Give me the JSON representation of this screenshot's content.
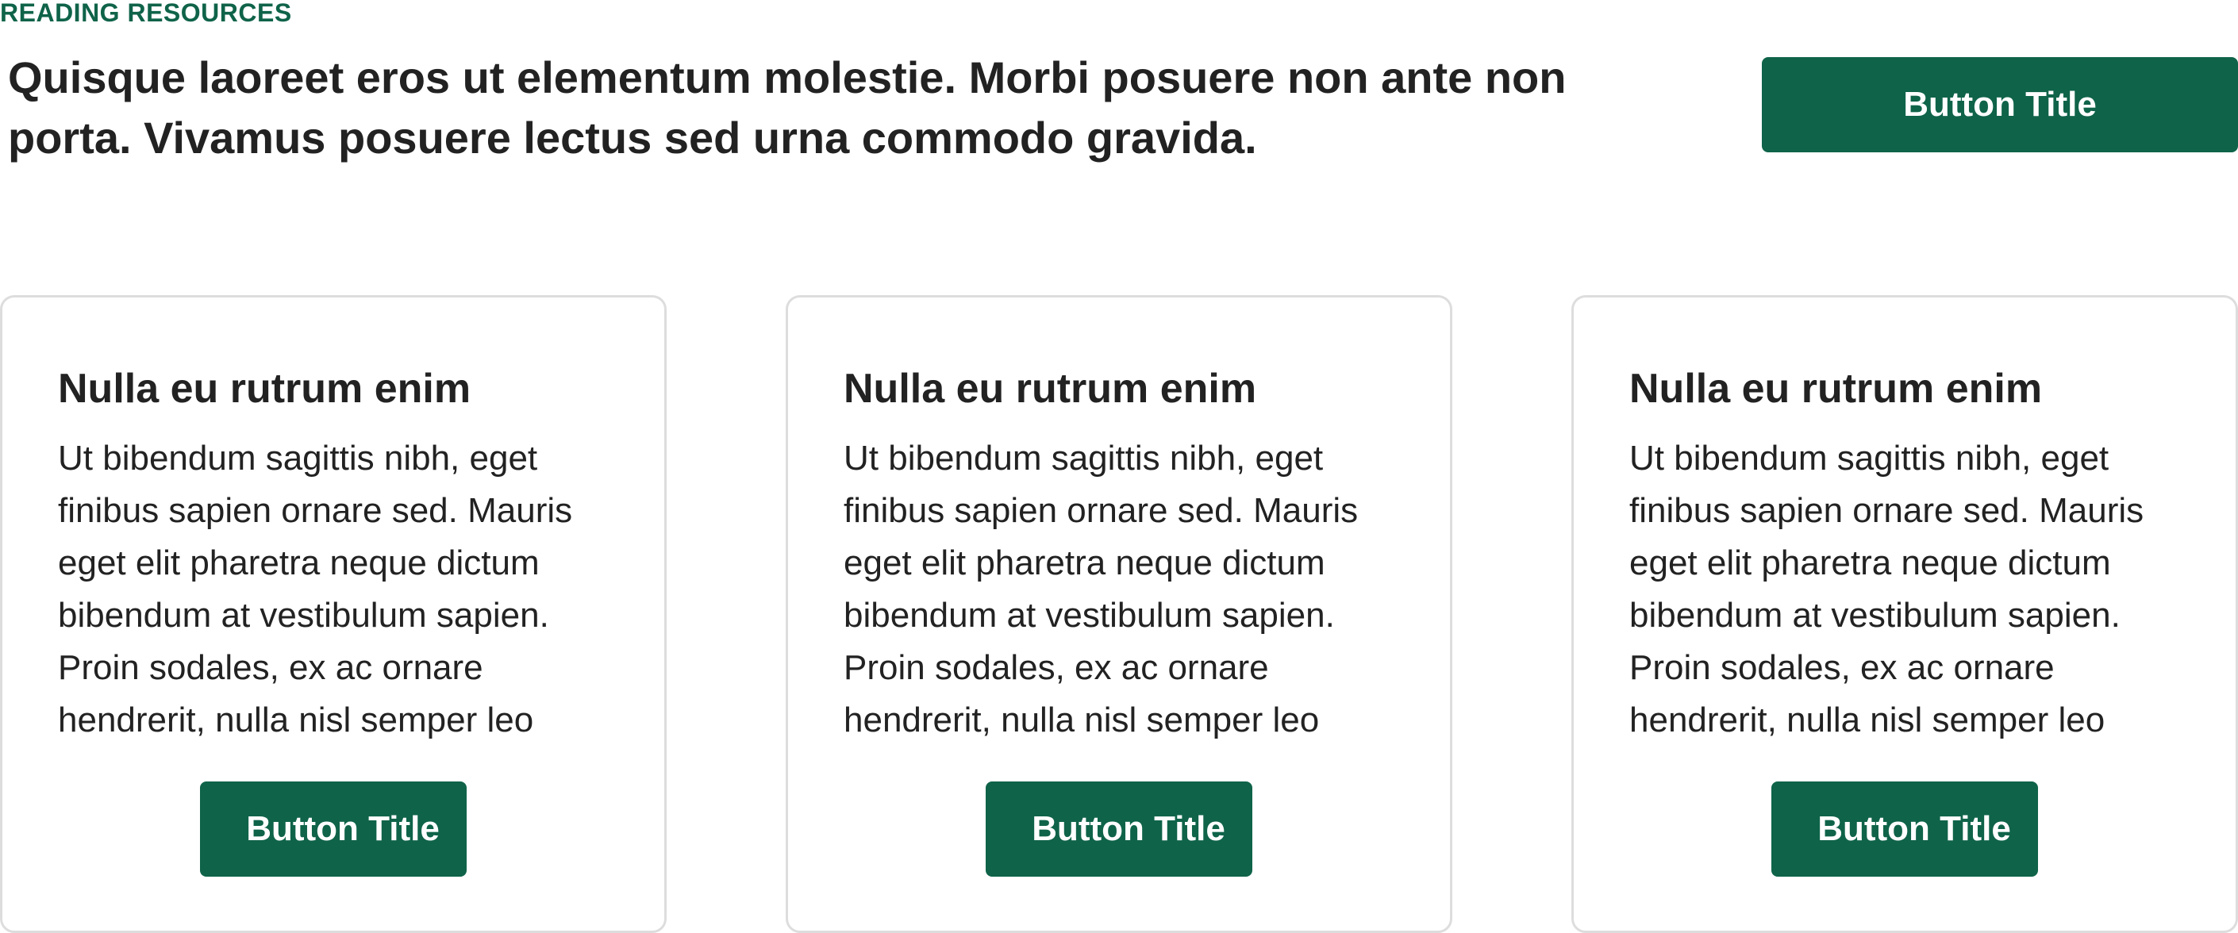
{
  "section": {
    "eyebrow": "READING RESOURCES",
    "headline": "Quisque laoreet eros ut elementum molestie. Morbi posuere non ante non porta. Vivamus posuere lectus sed urna commodo gravida.",
    "button_label": "Button Title"
  },
  "cards": [
    {
      "title": "Nulla eu rutrum enim",
      "body": "Ut bibendum sagittis nibh, eget finibus sapien ornare sed. Mauris eget elit pharetra neque dictum bibendum at vestibulum sapien. Proin sodales, ex ac ornare hendrerit, nulla nisl semper leo",
      "button_label": "Button Title"
    },
    {
      "title": "Nulla eu rutrum enim",
      "body": "Ut bibendum sagittis nibh, eget finibus sapien ornare sed. Mauris eget elit pharetra neque dictum bibendum at vestibulum sapien. Proin sodales, ex ac ornare hendrerit, nulla nisl semper leo",
      "button_label": "Button Title"
    },
    {
      "title": "Nulla eu rutrum enim",
      "body": "Ut bibendum sagittis nibh, eget finibus sapien ornare sed. Mauris eget elit pharetra neque dictum bibendum at vestibulum sapien. Proin sodales, ex ac ornare hendrerit, nulla nisl semper leo",
      "button_label": "Button Title"
    }
  ],
  "colors": {
    "accent": "#0f6349",
    "text": "#222222",
    "card_border": "#dddddd",
    "button_text": "#ffffff"
  }
}
